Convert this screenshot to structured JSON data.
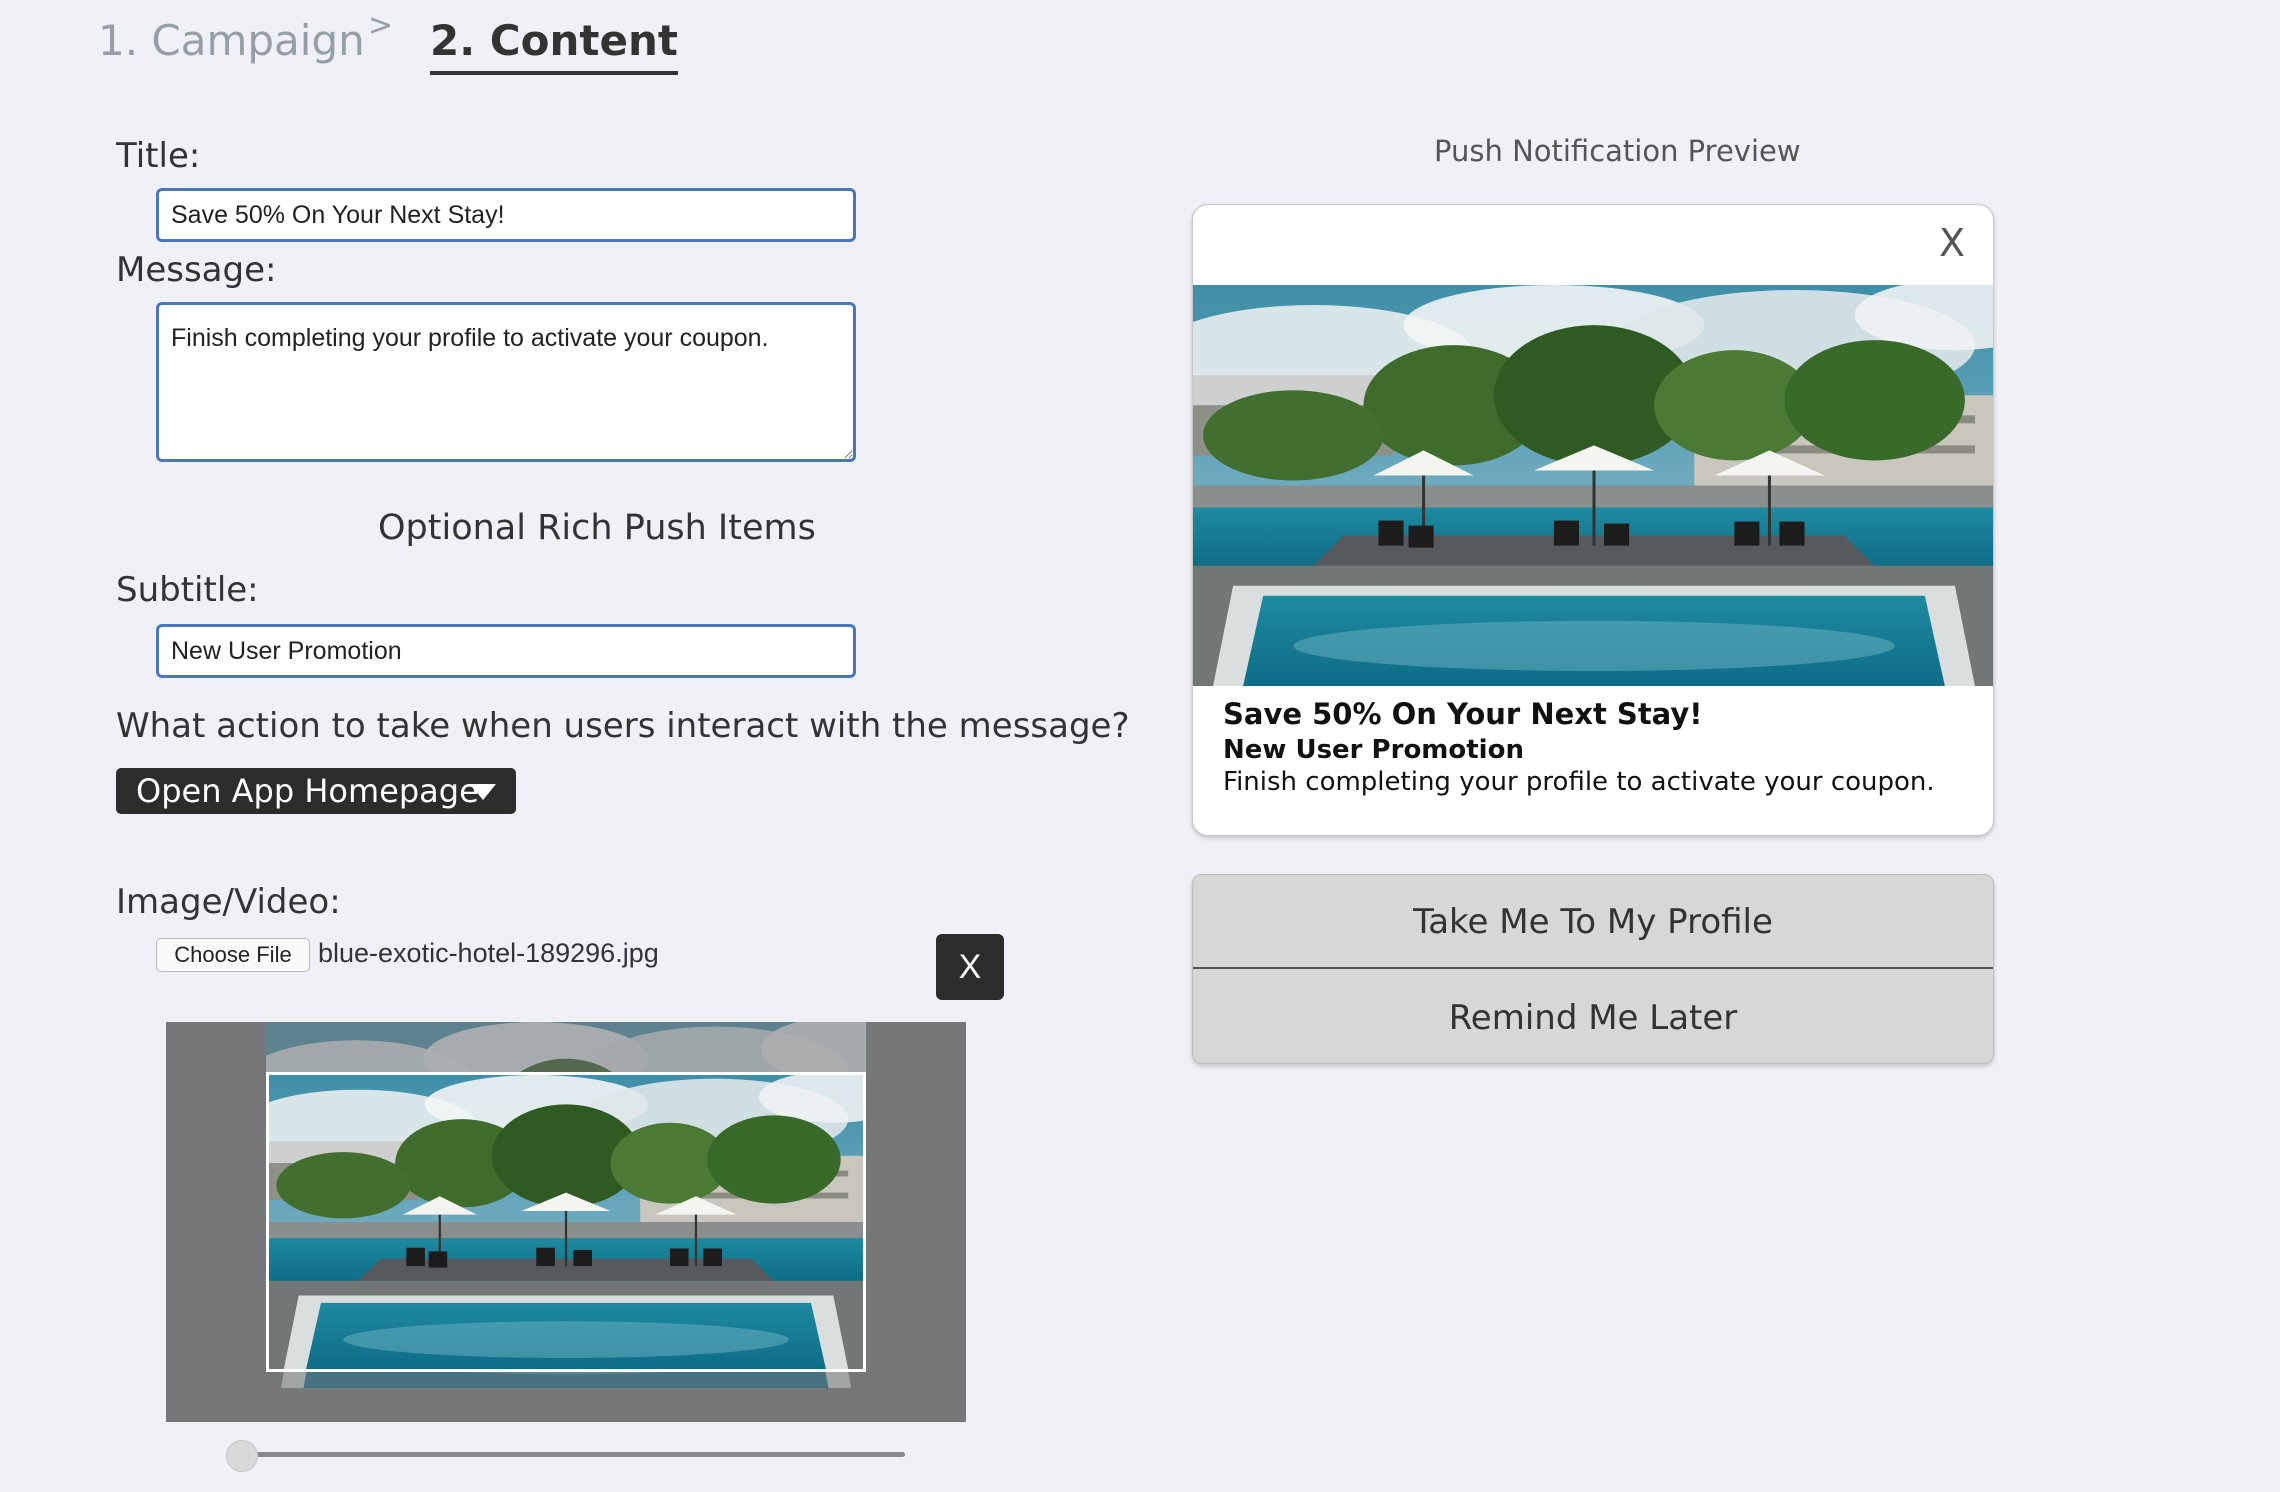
{
  "steps": {
    "campaign": "1. Campaign",
    "separator": ">",
    "content": "2. Content"
  },
  "form": {
    "title_label": "Title:",
    "title_value": "Save 50% On Your Next Stay!",
    "message_label": "Message:",
    "message_value": "Finish completing your profile to activate your coupon.",
    "rich_push_heading": "Optional Rich Push Items",
    "subtitle_label": "Subtitle:",
    "subtitle_value": "New User Promotion",
    "action_question": "What action to take when users interact with the message?",
    "action_selected": "Open App Homepage",
    "media_label": "Image/Video:",
    "choose_file_label": "Choose File",
    "file_name": "blue-exotic-hotel-189296.jpg",
    "remove_file_label": "X"
  },
  "cropper": {
    "zoom_level": 0
  },
  "preview": {
    "heading": "Push Notification Preview",
    "close_label": "X",
    "title": "Save 50% On Your Next Stay!",
    "subtitle": "New User Promotion",
    "message": "Finish completing your profile to activate your coupon.",
    "buttons": [
      "Take Me To My Profile",
      "Remind Me Later"
    ]
  },
  "colors": {
    "background": "#f0f1f6",
    "input_border": "#4a76c0",
    "dark_button": "#2c2c2c",
    "action_bg": "#d7d7d7"
  }
}
